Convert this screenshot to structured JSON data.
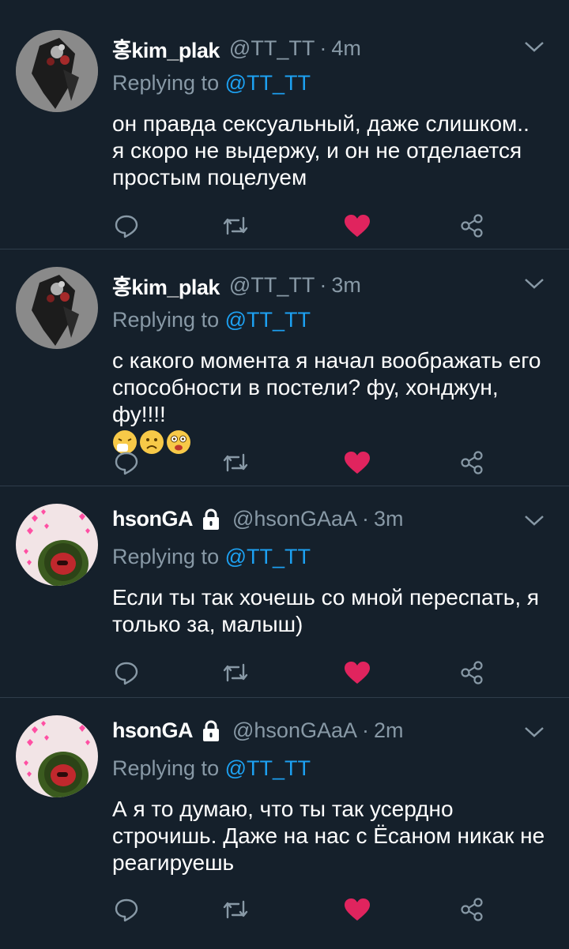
{
  "theme": {
    "background": "#15202b",
    "divider": "#2f3d4b",
    "muted": "#8899a6",
    "link": "#1da1f2",
    "like": "#e0245e"
  },
  "tweets": [
    {
      "name": "홍kim_plak",
      "handle": "@TT_TT",
      "time": "4m",
      "locked": false,
      "reply_prefix": "Replying to",
      "reply_to": "@TT_TT",
      "text_lines": [
        "он правда сексуальный, даже слишком..",
        "я скоро не выдержу, и он не отделается",
        "простым поцелуем"
      ],
      "liked": true,
      "avatar": "bouquet-avatar"
    },
    {
      "name": "홍kim_plak",
      "handle": "@TT_TT",
      "time": "3m",
      "locked": false,
      "reply_prefix": "Replying to",
      "reply_to": "@TT_TT",
      "text_lines": [
        "с какого момента я начал воображать его",
        "способности в постели? фу, хонджун, фу!!!!"
      ],
      "emojis": [
        "sneezing-face",
        "frowning-face",
        "flushed-face"
      ],
      "liked": true,
      "avatar": "bouquet-avatar"
    },
    {
      "name": "hsonGA",
      "handle": "@hsonGAaA",
      "time": "3m",
      "locked": true,
      "reply_prefix": "Replying to",
      "reply_to": "@TT_TT",
      "text_lines": [
        "Если ты так хочешь со мной переспать, я",
        "только за, малыш)"
      ],
      "liked": true,
      "avatar": "frog-hearts-avatar"
    },
    {
      "name": "hsonGA",
      "handle": "@hsonGAaA",
      "time": "2m",
      "locked": true,
      "reply_prefix": "Replying to",
      "reply_to": "@TT_TT",
      "text_lines": [
        "А я то думаю, что ты так усердно",
        "строчишь. Даже на нас с Ёсаном никак не",
        "реагируешь"
      ],
      "liked": true,
      "avatar": "frog-hearts-avatar"
    }
  ]
}
